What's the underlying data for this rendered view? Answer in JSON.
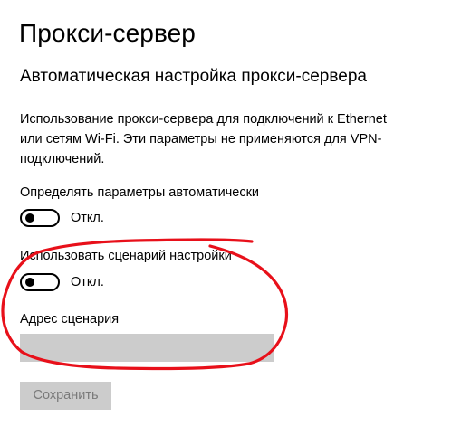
{
  "page": {
    "title": "Прокси-сервер",
    "section_title": "Автоматическая настройка прокси-сервера",
    "description_lines": [
      "Использование прокси-сервера для подключений к Ethernet",
      "или сетям Wi-Fi. Эти параметры не применяются для VPN-",
      "подключений."
    ]
  },
  "auto_detect": {
    "label": "Определять параметры автоматически",
    "state_label": "Откл.",
    "on": false
  },
  "setup_script": {
    "label": "Использовать сценарий настройки",
    "state_label": "Откл.",
    "on": false
  },
  "script_address": {
    "label": "Адрес сценария",
    "value": ""
  },
  "actions": {
    "save_label": "Сохранить"
  },
  "colors": {
    "annotation": "#e8101a",
    "disabled_fill": "#cccccc",
    "disabled_text": "#7a7a7a"
  }
}
